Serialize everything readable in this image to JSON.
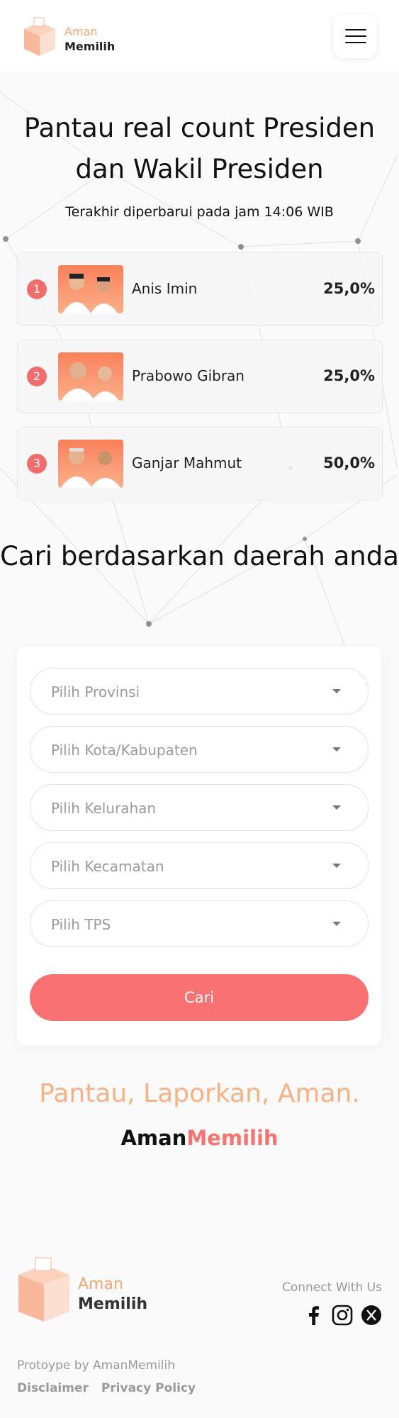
{
  "header": {
    "logo_line1": "Aman",
    "logo_line2": "Memilih",
    "menu_icon": "hamburger-menu-icon"
  },
  "hero": {
    "title": "Pantau real count Presiden dan Wakil Presiden",
    "updated": "Terakhir diperbarui pada jam 14:06 WIB"
  },
  "candidates": [
    {
      "number": "1",
      "name": "Anis Imin",
      "percent": "25,0%"
    },
    {
      "number": "2",
      "name": "Prabowo Gibran",
      "percent": "25,0%"
    },
    {
      "number": "3",
      "name": "Ganjar Mahmut",
      "percent": "50,0%"
    }
  ],
  "search": {
    "title": "Cari berdasarkan daerah anda",
    "fields": [
      {
        "placeholder": "Pilih Provinsi"
      },
      {
        "placeholder": "Pilih Kota/Kabupaten"
      },
      {
        "placeholder": "Pilih Kelurahan"
      },
      {
        "placeholder": "Pilih Kecamatan"
      },
      {
        "placeholder": "Pilih TPS"
      }
    ],
    "button": "Cari"
  },
  "slogan": {
    "tagline": "Pantau, Laporkan, Aman.",
    "brand_part1": "Aman",
    "brand_part2": "Memilih"
  },
  "footer": {
    "logo_line1": "Aman",
    "logo_line2": "Memilih",
    "connect": "Connect With Us",
    "social_icons": [
      "facebook-icon",
      "instagram-icon",
      "x-twitter-icon"
    ],
    "prototype": "Protoype by AmanMemilih",
    "links": [
      "Disclaimer",
      "Privacy Policy"
    ]
  },
  "colors": {
    "accent": "#f87272",
    "orange": "#f9b183",
    "muted": "#9a9a9a"
  }
}
